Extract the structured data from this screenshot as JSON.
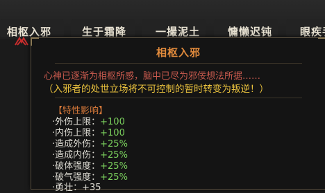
{
  "tabs": [
    {
      "label": "相枢入邪",
      "active": true
    },
    {
      "label": "生于霜降",
      "active": false
    },
    {
      "label": "一撮泥土",
      "active": false
    },
    {
      "label": "慵懒迟钝",
      "active": false
    },
    {
      "label": "眼疾手",
      "active": false
    }
  ],
  "tooltip": {
    "title": "相枢入邪",
    "description": "心神已逐渐为相枢所感，脑中已尽为邪佞想法所据……",
    "warning": "（入邪者的处世立场将不可控制的暂时转变为叛逆！）",
    "section_title": "【特性影响】",
    "stats": [
      {
        "label": "·外伤上限：",
        "value": "+100"
      },
      {
        "label": "·内伤上限：",
        "value": "+100"
      },
      {
        "label": "·造成外伤：",
        "value": "+25%"
      },
      {
        "label": "·造成内伤：",
        "value": "+25%"
      },
      {
        "label": "·破体强度：",
        "value": "+25%"
      },
      {
        "label": "·破气强度：",
        "value": "+25%"
      },
      {
        "label": "·勇壮：",
        "value": "+35"
      }
    ]
  },
  "colors": {
    "title": "#e08a3c",
    "description": "#c95a4e",
    "warning": "#ecc43e",
    "positive_value": "#7cd35e"
  },
  "icons": [
    "evil-mark-icon",
    "halo-icon",
    "frost-mark-icon",
    "soil-mark-icon",
    "sloth-mark-icon"
  ]
}
